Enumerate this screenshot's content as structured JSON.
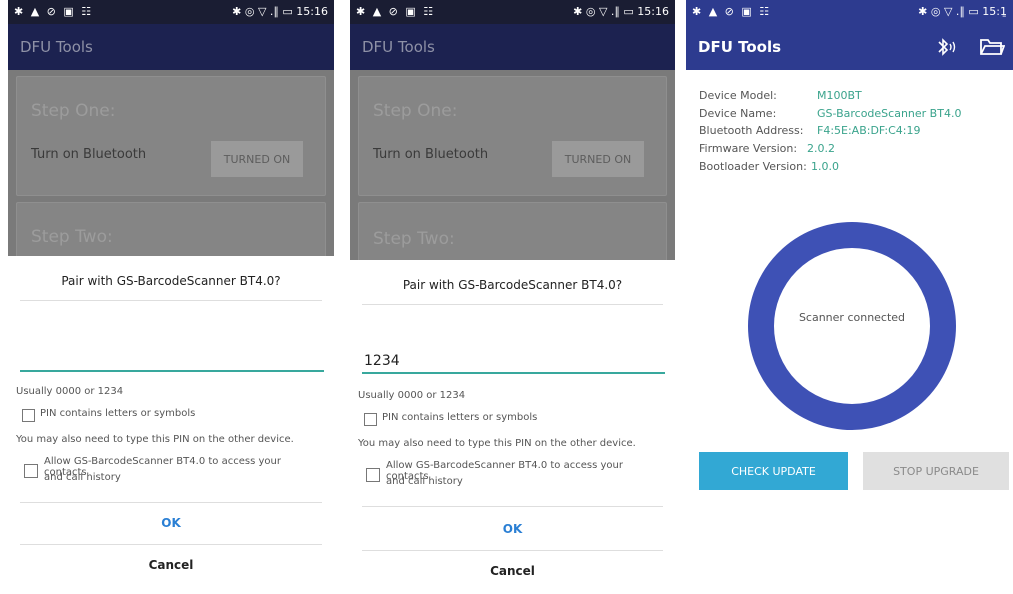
{
  "status": {
    "left_icons": "✱ ▲ ⊘ ▣ ☷",
    "right": "✱ ◎ ▽ .∥ ▭ 15:16",
    "right_partial": "✱ ◎ ▽ .∥ ▭ 15:1̱"
  },
  "app": {
    "title": "DFU Tools"
  },
  "background": {
    "step_one": "Step One:",
    "turn_on_bluetooth": "Turn on Bluetooth",
    "turned_on": "TURNED ON",
    "step_two": "Step Two:"
  },
  "dialog": {
    "title": "Pair with GS-BarcodeScanner  BT4.0?",
    "pin_empty": "",
    "pin_filled": "1234",
    "hint": "Usually 0000 or 1234",
    "pin_letters": "PIN contains letters or symbols",
    "other_device": "You may also need to type this PIN on the other device.",
    "allow_line1": "Allow GS-BarcodeScanner  BT4.0 to access your contacts",
    "allow_line2": "and call history",
    "ok": "OK",
    "cancel": "Cancel"
  },
  "device": {
    "model_label": "Device Model:",
    "model_value": "M100BT",
    "name_label": "Device Name:",
    "name_value": "GS-BarcodeScanner  BT4.0",
    "address_label": "Bluetooth Address:",
    "address_value": "F4:5E:AB:DF:C4:19",
    "firmware_label": "Firmware Version:",
    "firmware_value": "2.0.2",
    "bootloader_label": "Bootloader Version:",
    "bootloader_value": "1.0.0"
  },
  "scanner_status": "Scanner connected",
  "buttons": {
    "check_update": "CHECK UPDATE",
    "stop_upgrade": "STOP UPGRADE"
  },
  "colors": {
    "appbar": "#2d3b8f",
    "accent_teal": "#38a89d",
    "ring": "#3e51b5",
    "check_button": "#32a8d4",
    "ok_text": "#2a7fd4"
  },
  "icons": [
    "bluetooth-icon",
    "folder-icon",
    "checkbox-icon"
  ]
}
